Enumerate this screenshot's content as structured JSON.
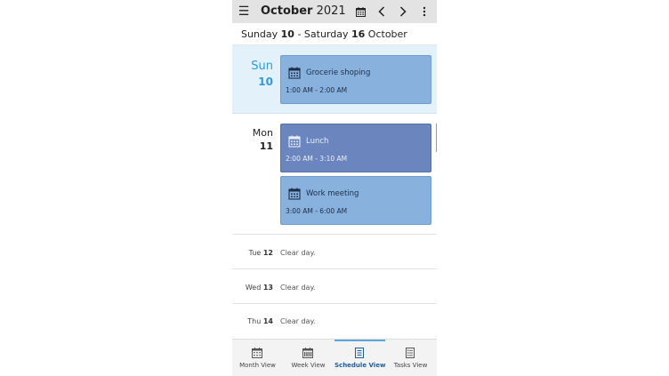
{
  "header": {
    "month": "October",
    "year": "2021",
    "menu_icon": "hamburger-menu-icon",
    "calendar_icon": "calendar-icon",
    "prev_icon": "chevron-left-icon",
    "next_icon": "chevron-right-icon",
    "more_icon": "more-vertical-icon"
  },
  "range": {
    "start_prefix": "Sunday ",
    "start_day": "10",
    "separator": " - Saturday ",
    "end_day": "16",
    "end_suffix": " October"
  },
  "days": [
    {
      "name": "Sun",
      "number": "10",
      "events": [
        {
          "title": "Grocerie shoping",
          "time": "1:00 AM - 2:00 AM",
          "icon": "calendar-icon"
        }
      ]
    },
    {
      "name": "Mon",
      "number": "11",
      "events": [
        {
          "title": "Lunch",
          "time": "2:00 AM - 3:10 AM",
          "icon": "calendar-icon"
        },
        {
          "title": "Work meeting",
          "time": "3:00 AM - 6:00 AM",
          "icon": "calendar-icon"
        }
      ]
    }
  ],
  "clear_days": [
    {
      "name": "Tue",
      "number": "12",
      "text": "Clear day."
    },
    {
      "name": "Wed",
      "number": "13",
      "text": "Clear day."
    },
    {
      "name": "Thu",
      "number": "14",
      "text": "Clear day."
    }
  ],
  "nav": [
    {
      "label": "Month View",
      "icon": "month-calendar-icon"
    },
    {
      "label": "Week View",
      "icon": "week-calendar-icon"
    },
    {
      "label": "Schedule View",
      "icon": "schedule-list-icon",
      "active": true
    },
    {
      "label": "Tasks View",
      "icon": "tasks-list-icon"
    }
  ],
  "colors": {
    "accent": "#2f9ad8",
    "event_light": "#88b1de",
    "event_dark": "#6b86bf",
    "today_bg": "#e2f1fa"
  }
}
